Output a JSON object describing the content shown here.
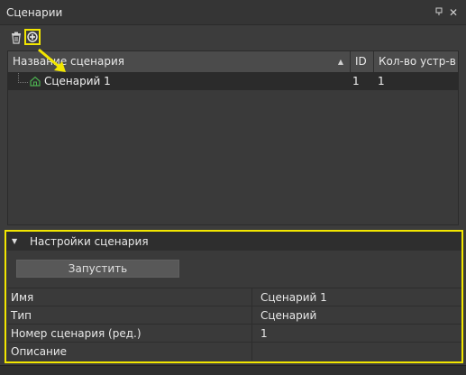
{
  "panel": {
    "title": "Сценарии",
    "pin_icon": "pin-icon",
    "close_icon": "close-icon"
  },
  "toolbar": {
    "delete_icon": "trash-icon",
    "add_icon": "plus-circle-icon"
  },
  "table": {
    "columns": [
      "Название сценария",
      "ID",
      "Кол-во устр-в"
    ],
    "rows": [
      {
        "name": "Сценарий 1",
        "id": "1",
        "count": "1",
        "icon": "scenario-home-icon"
      }
    ]
  },
  "settings": {
    "title": "Настройки сценария",
    "run_label": "Запустить",
    "props": [
      {
        "key": "Имя",
        "value": "Сценарий 1"
      },
      {
        "key": "Тип",
        "value": "Сценарий"
      },
      {
        "key": "Номер сценария (ред.)",
        "value": "1"
      },
      {
        "key": "Описание",
        "value": ""
      }
    ]
  },
  "colors": {
    "highlight": "#f2e600",
    "icon_green": "#4caf50"
  }
}
